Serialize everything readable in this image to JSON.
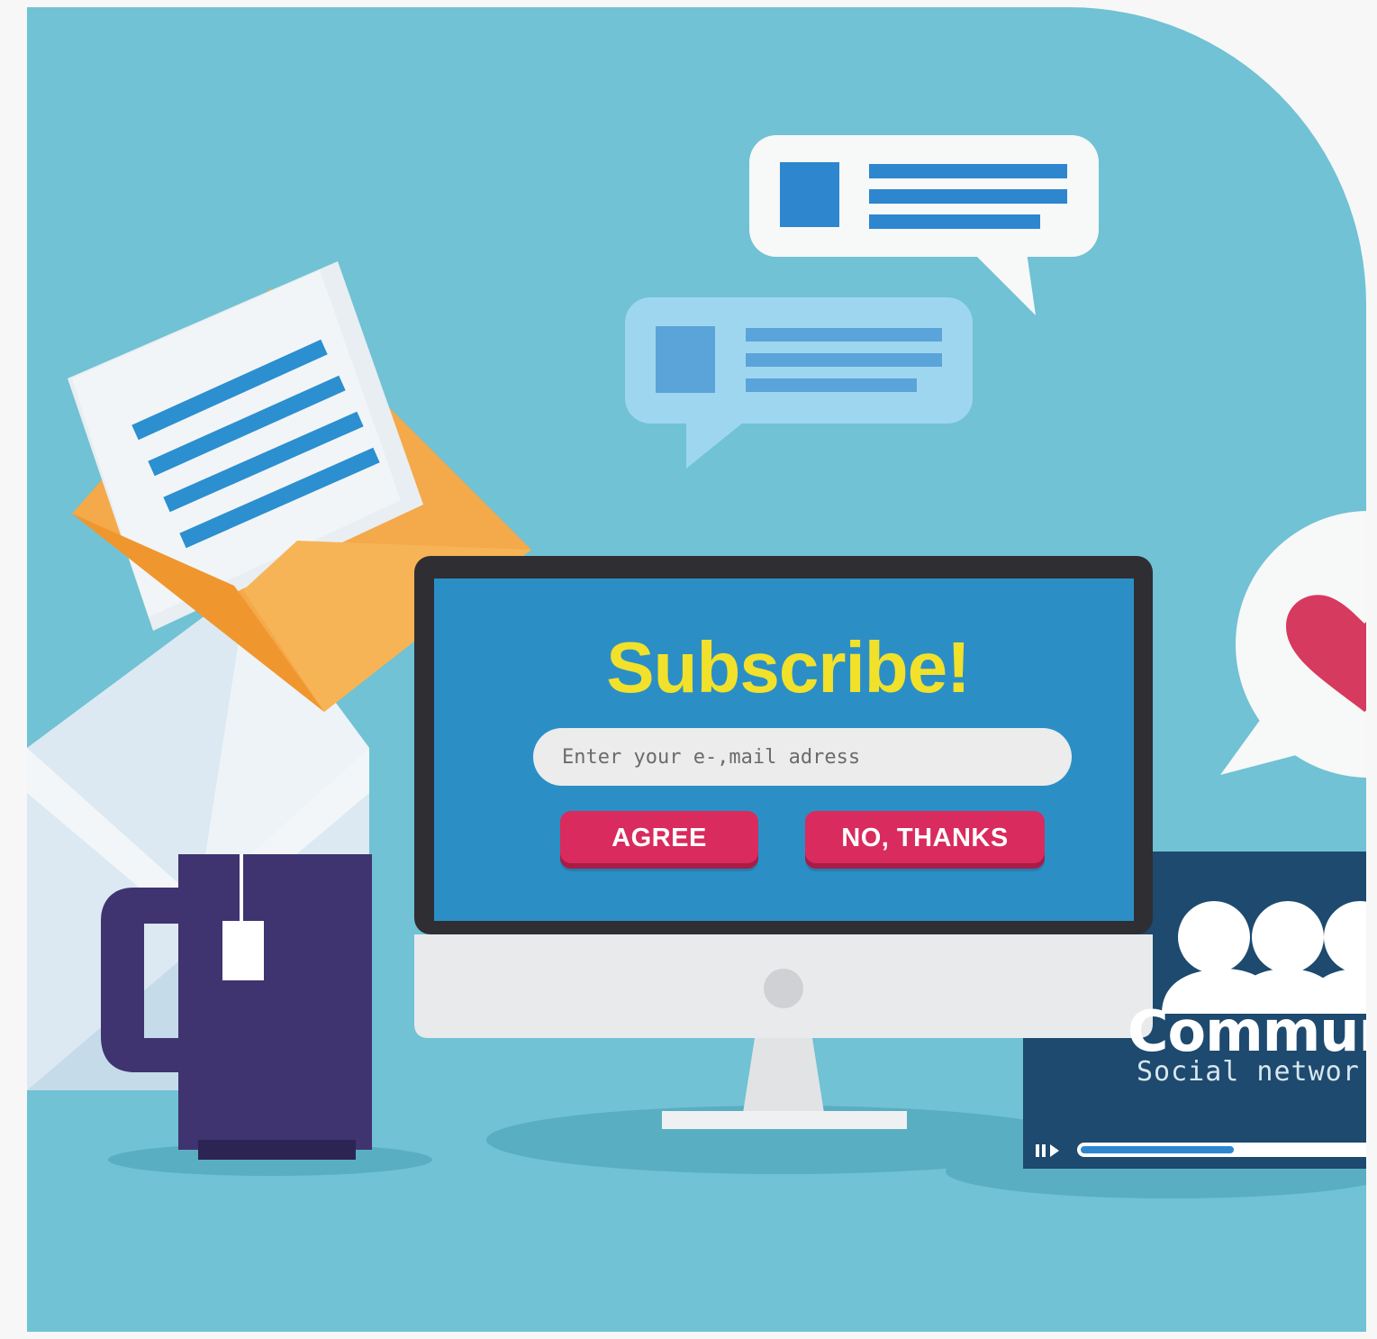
{
  "monitor": {
    "title": "Subscribe!",
    "email_placeholder": "Enter your e-,mail adress",
    "agree_label": "AGREE",
    "no_thanks_label": "NO, THANKS"
  },
  "video_card": {
    "title": "Communit",
    "subtitle": "Social networ"
  },
  "icons": [
    "envelope-icon",
    "chat-bubble-icon",
    "heart-icon",
    "mug-icon",
    "people-icon",
    "play-pause-icon"
  ],
  "colors": {
    "background": "#70c2d4",
    "screen": "#2b8fc6",
    "title": "#f2e12a",
    "button": "#d92b5d",
    "envelope": "#f4a94a",
    "mug": "#3f3470",
    "heart": "#d63a5e",
    "video_card": "#1d4a6e"
  }
}
